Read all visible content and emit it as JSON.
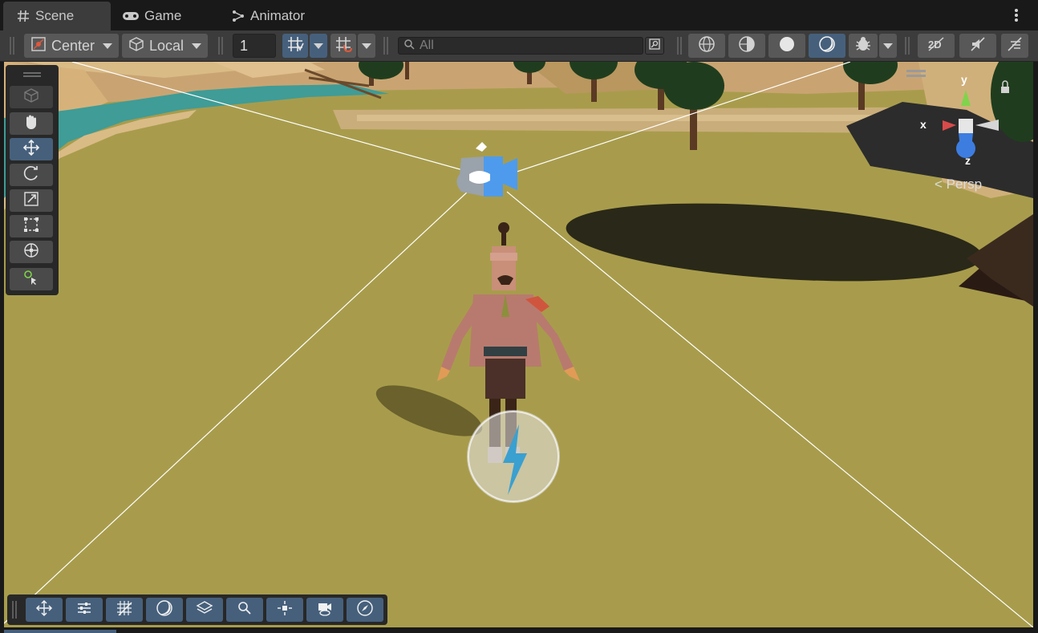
{
  "tabs": [
    {
      "label": "Scene",
      "icon": "hash-icon",
      "active": true
    },
    {
      "label": "Game",
      "icon": "gamepad-icon",
      "active": false
    },
    {
      "label": "Animator",
      "icon": "animator-icon",
      "active": false
    }
  ],
  "toolbar": {
    "pivot_label": "Center",
    "space_label": "Local",
    "grid_size_value": "1",
    "search_placeholder": "All"
  },
  "gizmo": {
    "y_label": "y",
    "x_label": "x",
    "z_label": "z",
    "projection_label": "Persp"
  },
  "colors": {
    "accent": "#46607c",
    "panel": "#3c3c3c",
    "ground": "#a89c4c",
    "water": "#3f9c97",
    "sand": "#d9bb86"
  }
}
